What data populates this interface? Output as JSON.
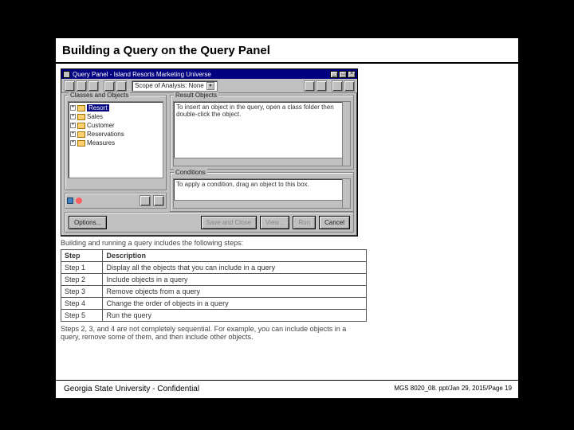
{
  "slide": {
    "title": "Building a Query on the Query Panel",
    "footer_left": "Georgia State University - Confidential",
    "footer_right": "MGS 8020_08. ppt/Jan 29, 2015/Page 19"
  },
  "win": {
    "title": "Query Panel - Island Resorts Marketing Universe",
    "scope_label": "Scope of Analysis: None",
    "groups": {
      "classes": "Classes and Objects",
      "result": "Result Objects",
      "conditions": "Conditions"
    },
    "tree": [
      {
        "icon": "folder",
        "label": "Resort",
        "selected": true,
        "expand": "+"
      },
      {
        "icon": "folder",
        "label": "Sales",
        "expand": "+"
      },
      {
        "icon": "folder",
        "label": "Customer",
        "expand": "+"
      },
      {
        "icon": "folder",
        "label": "Reservations",
        "expand": "+"
      },
      {
        "icon": "folder",
        "label": "Measures",
        "expand": "+"
      }
    ],
    "result_help": "To insert an object in the query, open a class folder then double-click the object.",
    "cond_help": "To apply a condition, drag an object to this box.",
    "buttons": {
      "options": "Options...",
      "save_close": "Save and Close",
      "view": "View...",
      "run": "Run",
      "cancel": "Cancel"
    }
  },
  "caption": "Building and running a query includes the following steps:",
  "table": {
    "headers": [
      "Step",
      "Description"
    ],
    "rows": [
      [
        "Step 1",
        "Display all the objects that you can include in a query"
      ],
      [
        "Step 2",
        "Include objects in a query"
      ],
      [
        "Step 3",
        "Remove objects from a query"
      ],
      [
        "Step 4",
        "Change the order of objects in a query"
      ],
      [
        "Step 5",
        "Run the query"
      ]
    ]
  },
  "note": "Steps 2, 3, and 4 are not completely sequential. For example, you can include objects in a query, remove some of them, and then include other objects."
}
